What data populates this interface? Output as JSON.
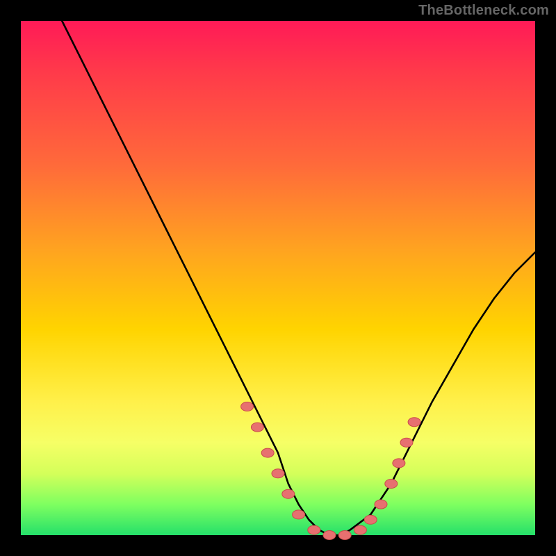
{
  "watermark": "TheBottleneck.com",
  "colors": {
    "background": "#000000",
    "gradient_top": "#ff1a57",
    "gradient_mid": "#ffd400",
    "gradient_bottom": "#25e06a",
    "curve": "#000000",
    "marker_fill": "#e77070",
    "marker_stroke": "#c94a4a"
  },
  "chart_data": {
    "type": "line",
    "title": "",
    "xlabel": "",
    "ylabel": "",
    "xlim": [
      0,
      100
    ],
    "ylim": [
      0,
      100
    ],
    "series": [
      {
        "name": "curve",
        "x": [
          8,
          12,
          16,
          20,
          24,
          28,
          32,
          36,
          40,
          44,
          48,
          50,
          52,
          54,
          56,
          58,
          60,
          62,
          64,
          68,
          72,
          76,
          80,
          84,
          88,
          92,
          96,
          100
        ],
        "y": [
          100,
          92,
          84,
          76,
          68,
          60,
          52,
          44,
          36,
          28,
          20,
          16,
          10,
          6,
          3,
          1,
          0,
          0,
          1,
          4,
          10,
          18,
          26,
          33,
          40,
          46,
          51,
          55
        ]
      }
    ],
    "markers": [
      {
        "x": 44,
        "y": 25
      },
      {
        "x": 46,
        "y": 21
      },
      {
        "x": 48,
        "y": 16
      },
      {
        "x": 50,
        "y": 12
      },
      {
        "x": 52,
        "y": 8
      },
      {
        "x": 54,
        "y": 4
      },
      {
        "x": 57,
        "y": 1
      },
      {
        "x": 60,
        "y": 0
      },
      {
        "x": 63,
        "y": 0
      },
      {
        "x": 66,
        "y": 1
      },
      {
        "x": 68,
        "y": 3
      },
      {
        "x": 70,
        "y": 6
      },
      {
        "x": 72,
        "y": 10
      },
      {
        "x": 73.5,
        "y": 14
      },
      {
        "x": 75,
        "y": 18
      },
      {
        "x": 76.5,
        "y": 22
      }
    ]
  }
}
